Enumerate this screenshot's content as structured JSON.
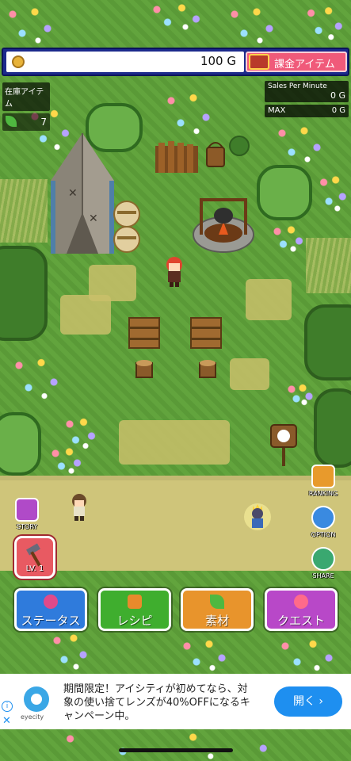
{
  "hud": {
    "money": "100 G",
    "premium_label": "課金アイテム",
    "stock_title": "在庫アイテム",
    "stock_count": "7",
    "sales_label": "Sales Per Minute",
    "sales_value": "0 G",
    "max_label": "MAX",
    "max_value": "0 G"
  },
  "side_buttons": {
    "story": "STORY",
    "ranking": "RANKING",
    "option": "OPTION",
    "share": "SHARE",
    "level": "LV. 1"
  },
  "menu": {
    "status": "ステータス",
    "recipe": "レシピ",
    "material": "素材",
    "quest": "クエスト"
  },
  "ad": {
    "brand": "eyecity",
    "text": "期間限定！アイシティが初めてなら、対象の使い捨てレンズが40%OFFになるキャンペーン中。",
    "cta": "開く ›",
    "info": "i",
    "close": "✕"
  },
  "colors": {
    "hud_bar": "#1c2a8c",
    "premium": "#f05a7a",
    "status_btn": "#2f7bdc",
    "recipe_btn": "#3fae2e",
    "material_btn": "#e8942c",
    "quest_btn": "#b848c8",
    "level_btn": "#e85a62"
  }
}
